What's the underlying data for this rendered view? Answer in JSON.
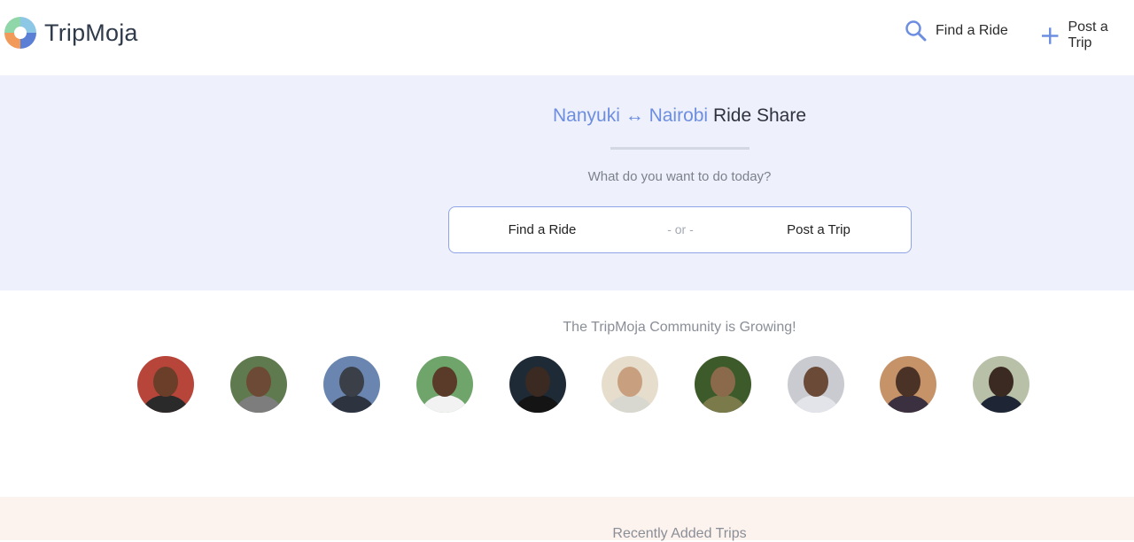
{
  "header": {
    "logo_text": "TripMoja",
    "nav": [
      {
        "label": "Find a Ride",
        "icon": "search-icon"
      },
      {
        "label": "Post a Trip",
        "icon": "plus-icon"
      }
    ]
  },
  "hero": {
    "from": "Nanyuki",
    "arrow": "↔",
    "to": "Nairobi",
    "suffix": "Ride Share",
    "subtitle": "What do you want to do today?",
    "find_label": "Find a Ride",
    "or_label": "- or -",
    "post_label": "Post a Trip"
  },
  "community": {
    "title": "The TripMoja Community is Growing!",
    "avatars": [
      {
        "bg": "#b8453a",
        "face": "#6b3e2a",
        "body": "#2a2a2a"
      },
      {
        "bg": "#5f7a4e",
        "face": "#6d4a35",
        "body": "#7d7d7d"
      },
      {
        "bg": "#6a86b0",
        "face": "#3b3f48",
        "body": "#2d3440"
      },
      {
        "bg": "#6fa56a",
        "face": "#5a3a28",
        "body": "#f2f2f2"
      },
      {
        "bg": "#1e2a36",
        "face": "#3a2a22",
        "body": "#141414"
      },
      {
        "bg": "#e6ddcd",
        "face": "#c9a07f",
        "body": "#d8d8d0"
      },
      {
        "bg": "#3d5a2a",
        "face": "#8a6a4a",
        "body": "#7a7a4a"
      },
      {
        "bg": "#c9cbd0",
        "face": "#6b4a38",
        "body": "#e2e4ea"
      },
      {
        "bg": "#c69268",
        "face": "#4a3226",
        "body": "#3a3040"
      },
      {
        "bg": "#b8c0a8",
        "face": "#3a2a22",
        "body": "#1e2636"
      }
    ]
  },
  "recent": {
    "title": "Recently Added Trips"
  }
}
